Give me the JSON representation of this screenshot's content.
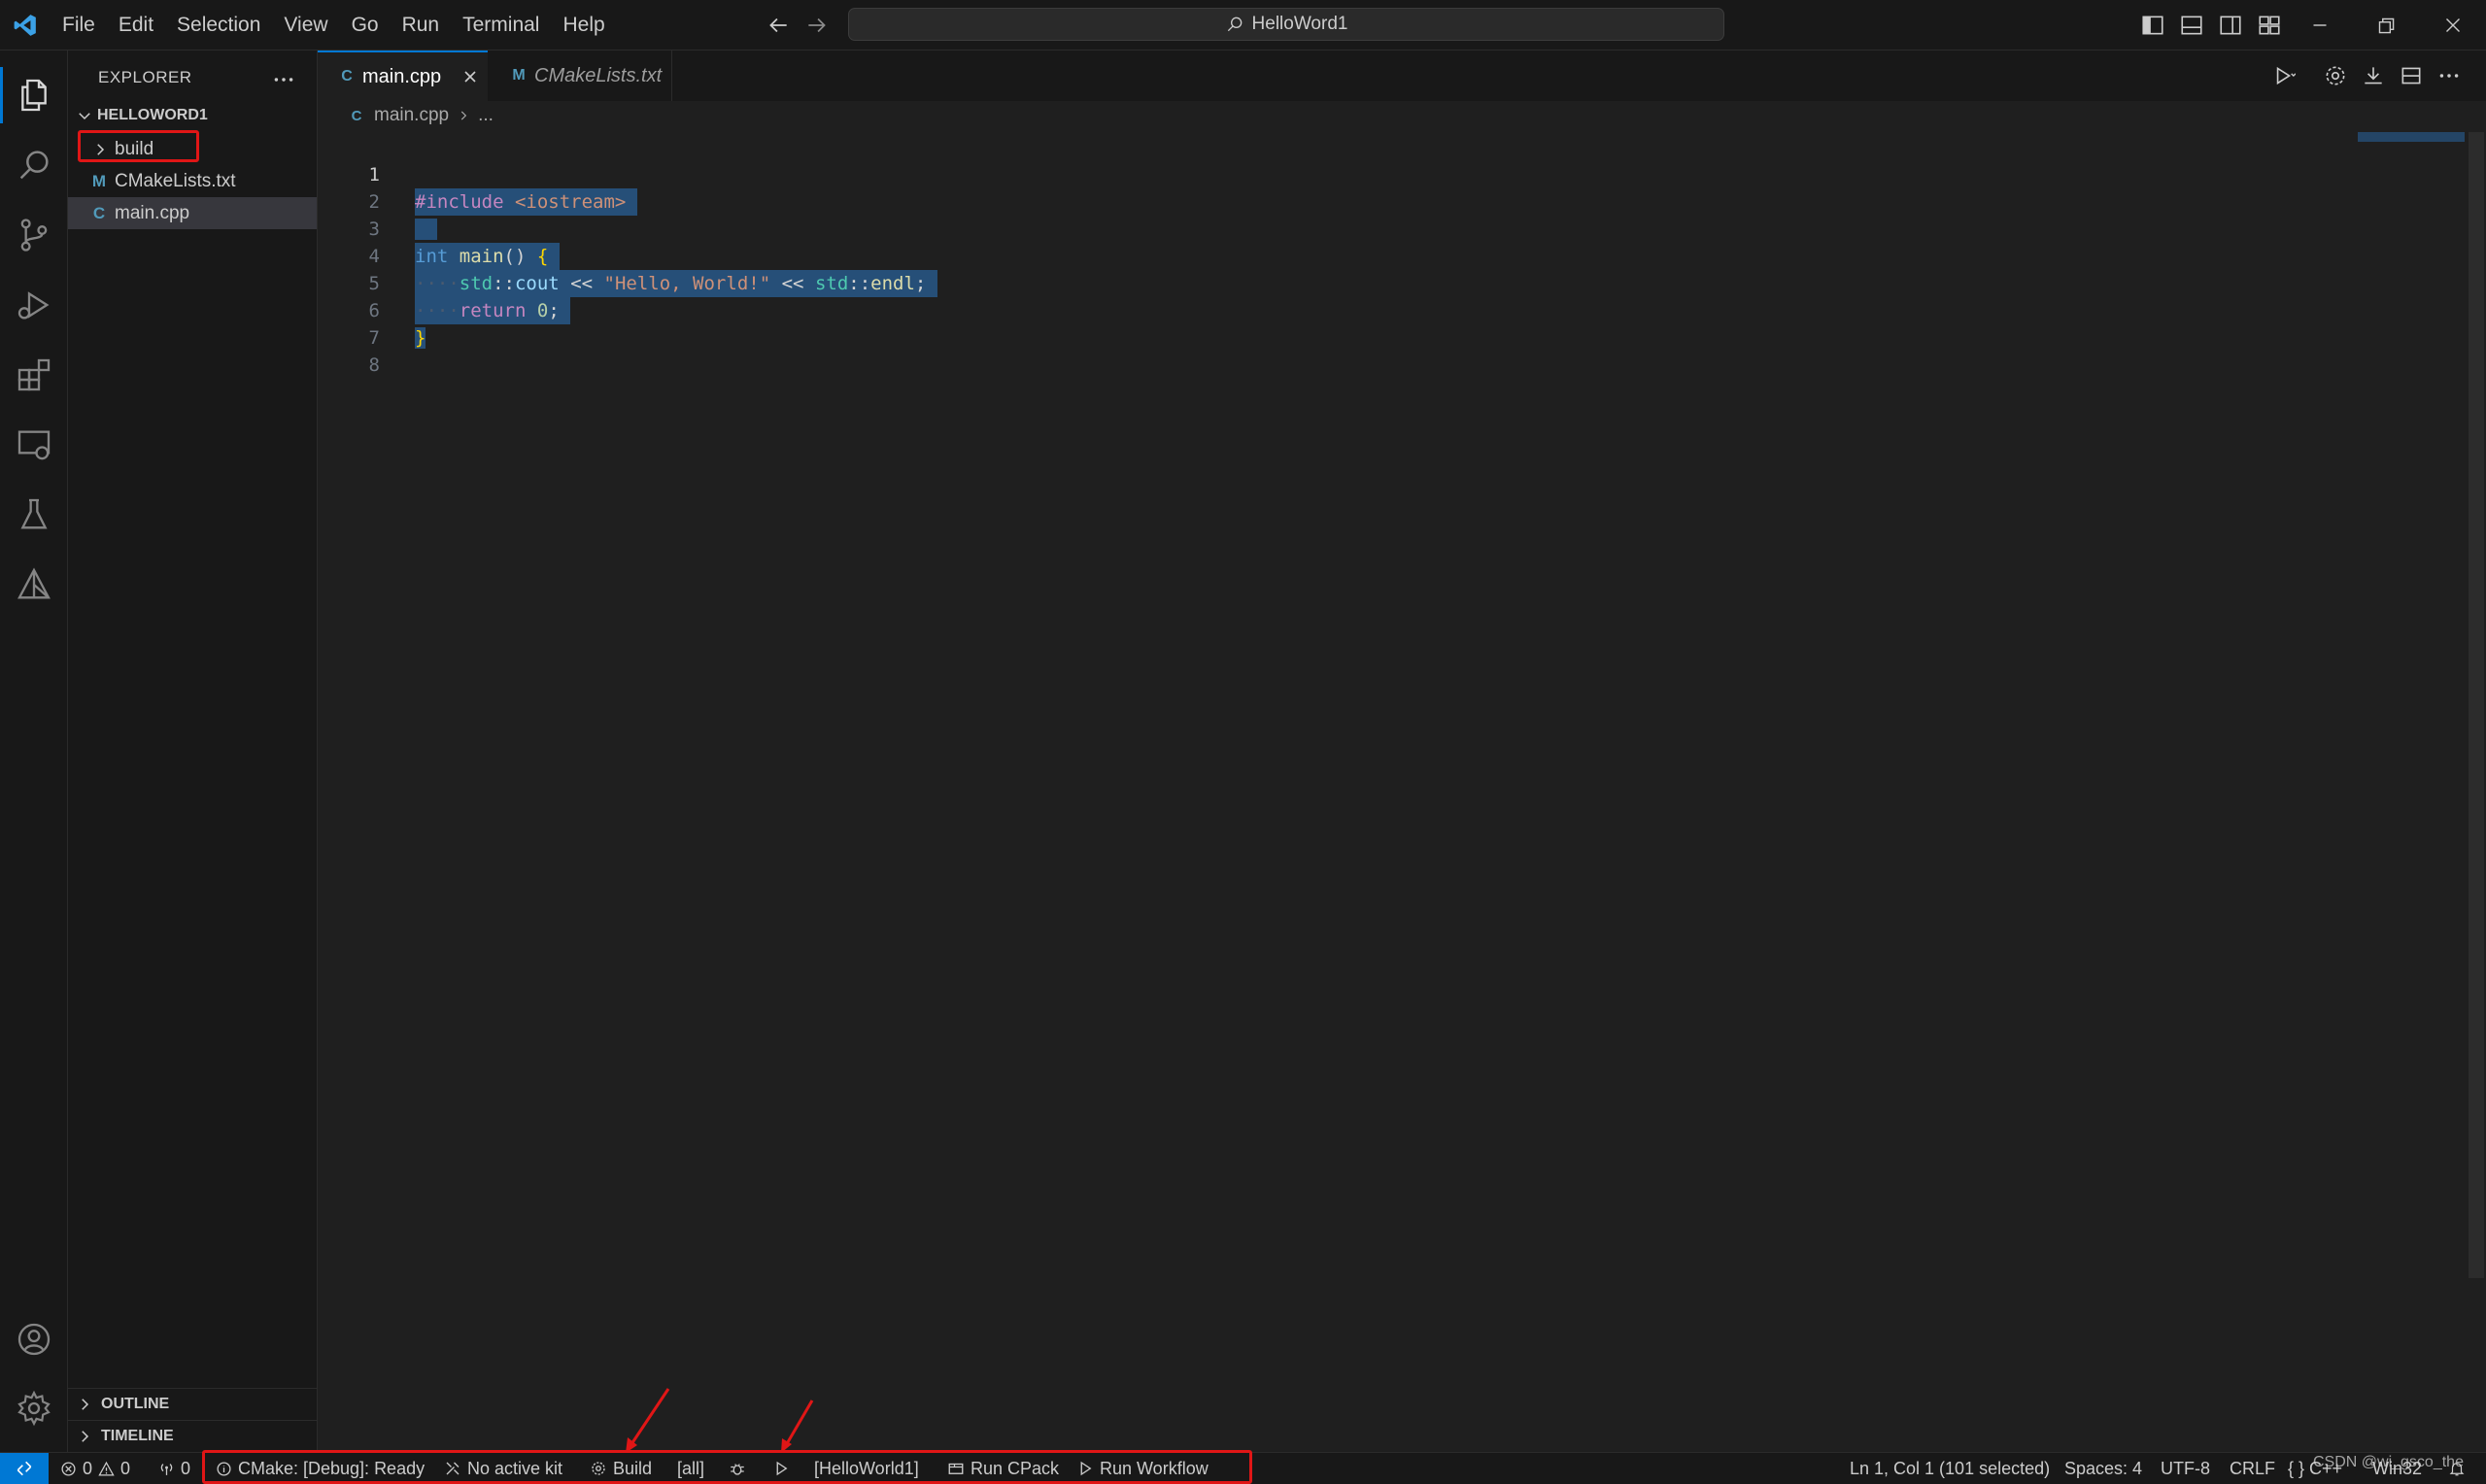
{
  "titlebar": {
    "menus": [
      "File",
      "Edit",
      "Selection",
      "View",
      "Go",
      "Run",
      "Terminal",
      "Help"
    ],
    "search_text": "HelloWord1"
  },
  "sidebar": {
    "title": "EXPLORER",
    "folder_name": "HELLOWORD1",
    "items": [
      {
        "label": "build",
        "type": "folder"
      },
      {
        "label": "CMakeLists.txt",
        "type": "cmake"
      },
      {
        "label": "main.cpp",
        "type": "cpp"
      }
    ],
    "sections": [
      "OUTLINE",
      "TIMELINE"
    ]
  },
  "editor": {
    "tabs": [
      {
        "label": "main.cpp",
        "active": true
      },
      {
        "label": "CMakeLists.txt",
        "active": false
      }
    ],
    "breadcrumb": {
      "file": "main.cpp",
      "rest": "..."
    },
    "line_numbers": [
      "1",
      "2",
      "3",
      "4",
      "5",
      "6",
      "7",
      "8"
    ]
  },
  "code_tokens": {
    "l1_directive": "#include",
    "l1_header": "<iostream>",
    "l3_int": "int",
    "l3_main": "main",
    "l3_parens": "()",
    "l3_brace": "{",
    "l4_ws": "····",
    "l4_std": "std",
    "l4_sep": "::",
    "l4_cout": "cout",
    "l4_op": "<<",
    "l4_str": "\"Hello, World!\"",
    "l4_endl": "endl",
    "l4_semi": ";",
    "l5_ws": "····",
    "l5_return": "return",
    "l5_zero": "0",
    "l5_semi": ";",
    "l6_brace": "}"
  },
  "statusbar": {
    "errors": "0",
    "warnings": "0",
    "ports": "0",
    "cmake_status": "CMake: [Debug]: Ready",
    "kit": "No active kit",
    "build": "Build",
    "target": "[all]",
    "launch_target": "[HelloWorld1]",
    "run_cpack": "Run CPack",
    "run_workflow": "Run Workflow",
    "cursor": "Ln 1, Col 1 (101 selected)",
    "spaces": "Spaces: 4",
    "encoding": "UTF-8",
    "eol": "CRLF",
    "language": "{ } C++",
    "platform": "Win32",
    "watermark": "CSDN @wi_gsco_the"
  },
  "colors": {
    "accent": "#0078d4",
    "highlight_box": "#e01616",
    "selection": "#264f78"
  }
}
